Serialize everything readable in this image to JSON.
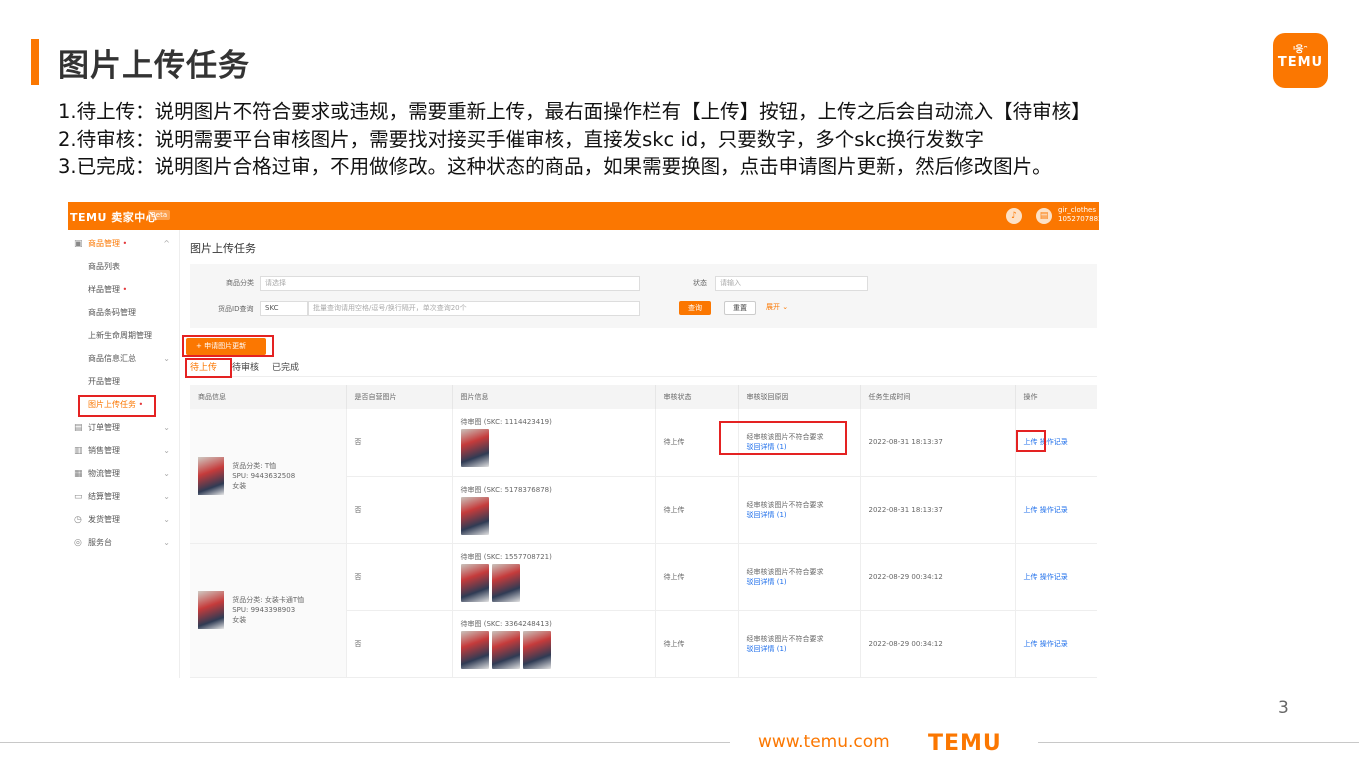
{
  "slide": {
    "title": "图片上传任务",
    "logo_top": "ᵎ웅ᵔ",
    "logo_bottom": "TEMU",
    "lines": [
      "1.待上传：说明图片不符合要求或违规，需要重新上传，最右面操作栏有【上传】按钮，上传之后会自动流入【待审核】",
      "2.待审核：说明需要平台审核图片，需要找对接买手催审核，直接发skc id，只要数字，多个skc换行发数字",
      "3.已完成：说明图片合格过审，不用做修改。这种状态的商品，如果需要换图，点击申请图片更新，然后修改图片。"
    ],
    "page_number": "3",
    "footer_url": "www.temu.com",
    "footer_logo": "TEMU"
  },
  "app": {
    "brand": "TEMU 卖家中心",
    "beta": "Beta",
    "user_name": "gir_clothes",
    "user_id": "1052707882",
    "bell_icon": "bell-icon",
    "avatar_icon": "store-icon",
    "sidebar": [
      {
        "label": "商品管理",
        "icon": "▣",
        "dot": "•",
        "chev": "^"
      },
      {
        "label": "商品列表"
      },
      {
        "label": "样品管理",
        "dot": "•"
      },
      {
        "label": "商品条码管理"
      },
      {
        "label": "上新生命周期管理"
      },
      {
        "label": "商品信息汇总",
        "chev": "⌄"
      },
      {
        "label": "开品管理"
      },
      {
        "label": "图片上传任务",
        "dot": "•",
        "active": true
      },
      {
        "label": "订单管理",
        "icon": "▤",
        "chev": "⌄"
      },
      {
        "label": "销售管理",
        "icon": "▥",
        "chev": "⌄"
      },
      {
        "label": "物流管理",
        "icon": "▦",
        "chev": "⌄"
      },
      {
        "label": "结算管理",
        "icon": "▭",
        "chev": "⌄"
      },
      {
        "label": "发货管理",
        "icon": "◷",
        "chev": "⌄"
      },
      {
        "label": "服务台",
        "icon": "◎",
        "chev": "⌄"
      }
    ],
    "main_title": "图片上传任务",
    "filters": {
      "category_label": "商品分类",
      "category_placeholder": "请选择",
      "status_label": "状态",
      "status_placeholder": "请输入",
      "id_label": "货品ID查询",
      "id_type": "SKC",
      "id_placeholder": "批量查询请用空格/逗号/换行隔开，单次查询20个",
      "query": "查询",
      "reset": "重置",
      "expand": "展开 ⌄"
    },
    "apply_button": "+ 申请图片更新",
    "tabs": [
      "待上传",
      "待审核",
      "已完成"
    ],
    "columns": [
      "商品信息",
      "是否自营图片",
      "图片信息",
      "审核状态",
      "审核驳回原因",
      "任务生成时间",
      "操作"
    ],
    "products": [
      {
        "name": "货品分类: T恤",
        "spu": "SPU: 9443632508",
        "extra": "女装",
        "rows": [
          {
            "self": "否",
            "skc": "待审图 (SKC: 1114423419)",
            "thumbs": 1,
            "status": "待上传",
            "reason": "经审核该图片不符合要求",
            "reason_link": "驳回详情 (1)",
            "time": "2022-08-31 18:13:37",
            "op": "上传 操作记录"
          },
          {
            "self": "否",
            "skc": "待审图 (SKC: 5178376878)",
            "thumbs": 1,
            "status": "待上传",
            "reason": "经审核该图片不符合要求",
            "reason_link": "驳回详情 (1)",
            "time": "2022-08-31 18:13:37",
            "op": "上传 操作记录"
          }
        ]
      },
      {
        "name": "货品分类: 女装卡通T恤",
        "spu": "SPU: 9943398903",
        "extra": "女装",
        "rows": [
          {
            "self": "否",
            "skc": "待审图 (SKC: 1557708721)",
            "thumbs": 2,
            "status": "待上传",
            "reason": "经审核该图片不符合要求",
            "reason_link": "驳回详情 (1)",
            "time": "2022-08-29 00:34:12",
            "op": "上传 操作记录"
          },
          {
            "self": "否",
            "skc": "待审图 (SKC: 3364248413)",
            "thumbs": 3,
            "status": "待上传",
            "reason": "经审核该图片不符合要求",
            "reason_link": "驳回详情 (1)",
            "time": "2022-08-29 00:34:12",
            "op": "上传 操作记录"
          }
        ]
      }
    ]
  },
  "colors": {
    "accent": "#fb7701",
    "highlight": "#e42222",
    "link": "#1f6feb"
  }
}
